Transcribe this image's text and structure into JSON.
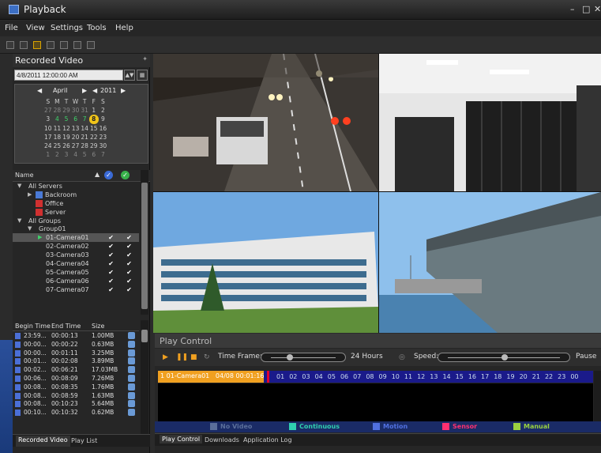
{
  "window": {
    "title": "Playback",
    "controls": [
      "–",
      "□",
      "✕"
    ]
  },
  "menu": [
    "File",
    "View",
    "Settings",
    "Tools",
    "Help"
  ],
  "recorded": {
    "title": "Recorded Video",
    "datetime": "4/8/2011 12:00:00 AM",
    "month": "April",
    "year": "2011",
    "weekdays": [
      "S",
      "M",
      "T",
      "W",
      "T",
      "F",
      "S"
    ],
    "weeks": [
      [
        "27",
        "28",
        "29",
        "30",
        "31",
        "1",
        "2"
      ],
      [
        "3",
        "4",
        "5",
        "6",
        "7",
        "8",
        "9"
      ],
      [
        "10",
        "11",
        "12",
        "13",
        "14",
        "15",
        "16"
      ],
      [
        "17",
        "18",
        "19",
        "20",
        "21",
        "22",
        "23"
      ],
      [
        "24",
        "25",
        "26",
        "27",
        "28",
        "29",
        "30"
      ],
      [
        "1",
        "2",
        "3",
        "4",
        "5",
        "6",
        "7"
      ]
    ],
    "selected_day": "8"
  },
  "tree": {
    "header": "Name",
    "items": [
      {
        "label": "All Servers",
        "level": 0,
        "expander": "▼"
      },
      {
        "label": "Backroom",
        "level": 1,
        "expander": "▶"
      },
      {
        "label": "Office",
        "level": 1,
        "expander": ""
      },
      {
        "label": "Server",
        "level": 1,
        "expander": ""
      },
      {
        "label": "All Groups",
        "level": 0,
        "expander": "▼"
      },
      {
        "label": "Group01",
        "level": 1,
        "expander": "▼"
      },
      {
        "label": "01-Camera01",
        "level": 2,
        "expander": "",
        "selected": true
      },
      {
        "label": "02-Camera02",
        "level": 2,
        "expander": ""
      },
      {
        "label": "03-Camera03",
        "level": 2,
        "expander": ""
      },
      {
        "label": "04-Camera04",
        "level": 2,
        "expander": ""
      },
      {
        "label": "05-Camera05",
        "level": 2,
        "expander": ""
      },
      {
        "label": "06-Camera06",
        "level": 2,
        "expander": ""
      },
      {
        "label": "07-Camera07",
        "level": 2,
        "expander": ""
      }
    ]
  },
  "clips": {
    "headers": [
      "Begin Time",
      "End Time",
      "Size"
    ],
    "rows": [
      [
        "23:59...",
        "00:00:13",
        "1.00MB"
      ],
      [
        "00:00...",
        "00:00:22",
        "0.63MB"
      ],
      [
        "00:00...",
        "00:01:11",
        "3.25MB"
      ],
      [
        "00:01...",
        "00:02:08",
        "3.89MB"
      ],
      [
        "00:02...",
        "00:06:21",
        "17.03MB"
      ],
      [
        "00:06...",
        "00:08:09",
        "7.26MB"
      ],
      [
        "00:08...",
        "00:08:35",
        "1.76MB"
      ],
      [
        "00:08...",
        "00:08:59",
        "1.63MB"
      ],
      [
        "00:08...",
        "00:10:23",
        "5.64MB"
      ],
      [
        "00:10...",
        "00:10:32",
        "0.62MB"
      ]
    ]
  },
  "left_tabs": [
    "Recorded Video",
    "Play List"
  ],
  "play": {
    "title": "Play Control",
    "timeframe_label": "Time Frame:",
    "timeframe_value": "24 Hours",
    "speed_label": "Speed:",
    "pause_label": "Pause",
    "camera": "1  01-Camera01",
    "timestamp": "04/08 00:01:16",
    "hours": [
      "01",
      "02",
      "03",
      "04",
      "05",
      "06",
      "07",
      "08",
      "09",
      "10",
      "11",
      "12",
      "13",
      "14",
      "15",
      "16",
      "17",
      "18",
      "19",
      "20",
      "21",
      "22",
      "23",
      "00"
    ]
  },
  "legend": [
    {
      "label": "No Video",
      "color": "#5a6e9a"
    },
    {
      "label": "Continuous",
      "color": "#2fd0b0"
    },
    {
      "label": "Motion",
      "color": "#5070e0"
    },
    {
      "label": "Sensor",
      "color": "#ff3070"
    },
    {
      "label": "Manual",
      "color": "#9ad040"
    }
  ],
  "bottom_tabs": [
    "Play Control",
    "Downloads",
    "Application Log"
  ]
}
